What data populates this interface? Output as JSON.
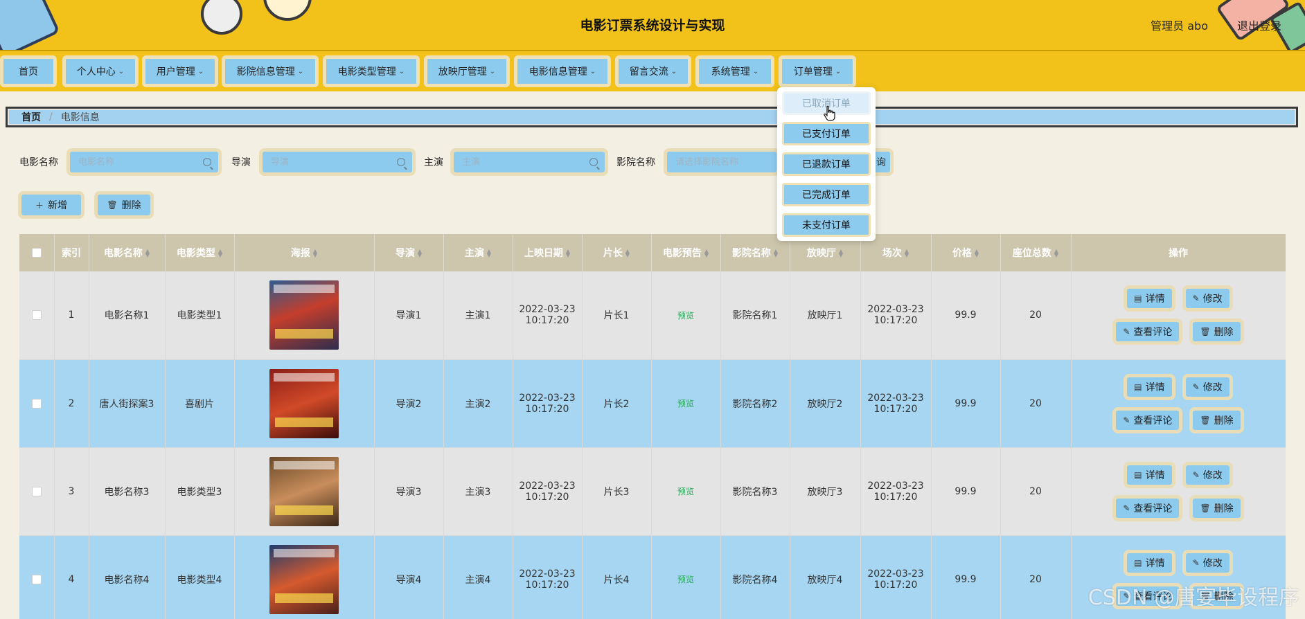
{
  "header": {
    "title": "电影订票系统设计与实现",
    "user": "管理员 abo",
    "logout": "退出登录"
  },
  "nav": {
    "items": [
      {
        "label": "首页",
        "has_caret": false
      },
      {
        "label": "个人中心",
        "has_caret": true
      },
      {
        "label": "用户管理",
        "has_caret": true
      },
      {
        "label": "影院信息管理",
        "has_caret": true
      },
      {
        "label": "电影类型管理",
        "has_caret": true
      },
      {
        "label": "放映厅管理",
        "has_caret": true
      },
      {
        "label": "电影信息管理",
        "has_caret": true
      },
      {
        "label": "留言交流",
        "has_caret": true
      },
      {
        "label": "系统管理",
        "has_caret": true
      },
      {
        "label": "订单管理",
        "has_caret": true
      }
    ],
    "caret": "⌄",
    "dropdown": [
      "已取消订单",
      "已支付订单",
      "已退款订单",
      "已完成订单",
      "未支付订单"
    ]
  },
  "breadcrumb": {
    "home": "首页",
    "sep": "/",
    "current": "电影信息"
  },
  "search": {
    "movie_name": {
      "label": "电影名称",
      "placeholder": "电影名称"
    },
    "director": {
      "label": "导演",
      "placeholder": "导演"
    },
    "actor": {
      "label": "主演",
      "placeholder": "主演"
    },
    "cinema": {
      "label": "影院名称",
      "placeholder": "请选择影院名称"
    },
    "search_stub": "询"
  },
  "actions": {
    "add": "新增",
    "delete": "删除"
  },
  "table": {
    "headers": [
      "索引",
      "电影名称",
      "电影类型",
      "海报",
      "导演",
      "主演",
      "上映日期",
      "片长",
      "电影预告",
      "影院名称",
      "放映厅",
      "场次",
      "价格",
      "座位总数",
      "操作"
    ],
    "rows": [
      {
        "index": "1",
        "name": "电影名称1",
        "type": "电影类型1",
        "director": "导演1",
        "actor": "主演1",
        "date1": "2022-03-23",
        "date2": "10:17:20",
        "length": "片长1",
        "preview": "预览",
        "cinema": "影院名称1",
        "hall": "放映厅1",
        "show1": "2022-03-23",
        "show2": "10:17:20",
        "price": "99.9",
        "seats": "20"
      },
      {
        "index": "2",
        "name": "唐人街探案3",
        "type": "喜剧片",
        "director": "导演2",
        "actor": "主演2",
        "date1": "2022-03-23",
        "date2": "10:17:20",
        "length": "片长2",
        "preview": "预览",
        "cinema": "影院名称2",
        "hall": "放映厅2",
        "show1": "2022-03-23",
        "show2": "10:17:20",
        "price": "99.9",
        "seats": "20"
      },
      {
        "index": "3",
        "name": "电影名称3",
        "type": "电影类型3",
        "director": "导演3",
        "actor": "主演3",
        "date1": "2022-03-23",
        "date2": "10:17:20",
        "length": "片长3",
        "preview": "预览",
        "cinema": "影院名称3",
        "hall": "放映厅3",
        "show1": "2022-03-23",
        "show2": "10:17:20",
        "price": "99.9",
        "seats": "20"
      },
      {
        "index": "4",
        "name": "电影名称4",
        "type": "电影类型4",
        "director": "导演4",
        "actor": "主演4",
        "date1": "2022-03-23",
        "date2": "10:17:20",
        "length": "片长4",
        "preview": "预览",
        "cinema": "影院名称4",
        "hall": "放映厅4",
        "show1": "2022-03-23",
        "show2": "10:17:20",
        "price": "99.9",
        "seats": "20"
      }
    ],
    "ops": {
      "detail": "详情",
      "edit": "修改",
      "comments": "查看评论",
      "delete": "删除"
    }
  },
  "watermark": "CSDN @唐宴毕设程序",
  "colors": {
    "header_bg": "#f2c21a",
    "button_bg": "#8dcbee",
    "button_border": "#e9ddb8",
    "row_even": "#a7d6f2",
    "row_odd": "#e4e4e4",
    "table_header": "#cdc6ad",
    "preview_link": "#2aa85a"
  }
}
